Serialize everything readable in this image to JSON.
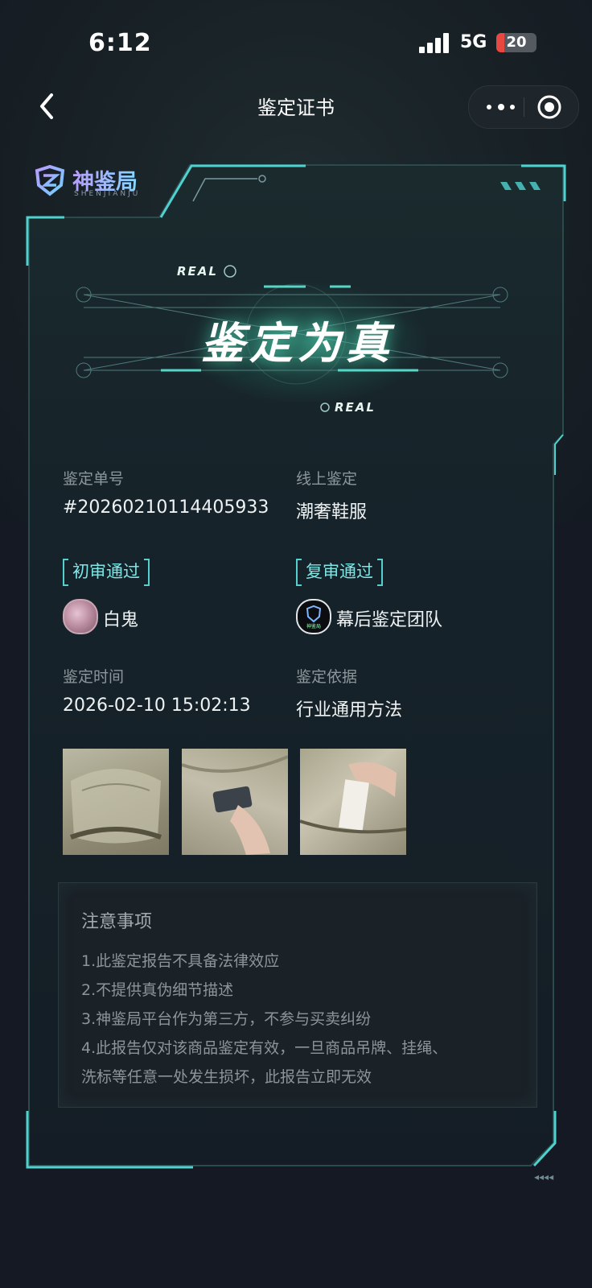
{
  "status_bar": {
    "time": "6:12",
    "network": "5G",
    "battery": "20",
    "battery_level": 0.2
  },
  "nav": {
    "title": "鉴定证书"
  },
  "logo": {
    "name": "神鉴局",
    "sub": "SHENJIANJU"
  },
  "hero": {
    "title": "鉴定为真",
    "tag_top": "REAL",
    "tag_bottom": "REAL"
  },
  "info": {
    "order_label": "鉴定单号",
    "order_value": "#20260210114405933",
    "channel_label": "线上鉴定",
    "channel_value": "潮奢鞋服",
    "first_review_badge": "初审通过",
    "first_reviewer": "白鬼",
    "second_review_badge": "复审通过",
    "second_reviewer": "幕后鉴定团队",
    "second_reviewer_avatar_text": "神鉴局",
    "time_label": "鉴定时间",
    "time_value": "2026-02-10 15:02:13",
    "basis_label": "鉴定依据",
    "basis_value": "行业通用方法"
  },
  "photos": [
    "bag-photo-overview",
    "bag-photo-tag",
    "bag-photo-wash-label"
  ],
  "notes": {
    "title": "注意事项",
    "lines": [
      "1.此鉴定报告不具备法律效应",
      "2.不提供真伪细节描述",
      "3.神鉴局平台作为第三方，不参与买卖纠纷",
      "4.此报告仅对该商品鉴定有效，一旦商品吊牌、挂绳、",
      "洗标等任意一处发生损坏，此报告立即无效"
    ]
  },
  "colors": {
    "accent": "#5fd8d8",
    "background": "#141a22",
    "card": "#16212a"
  }
}
